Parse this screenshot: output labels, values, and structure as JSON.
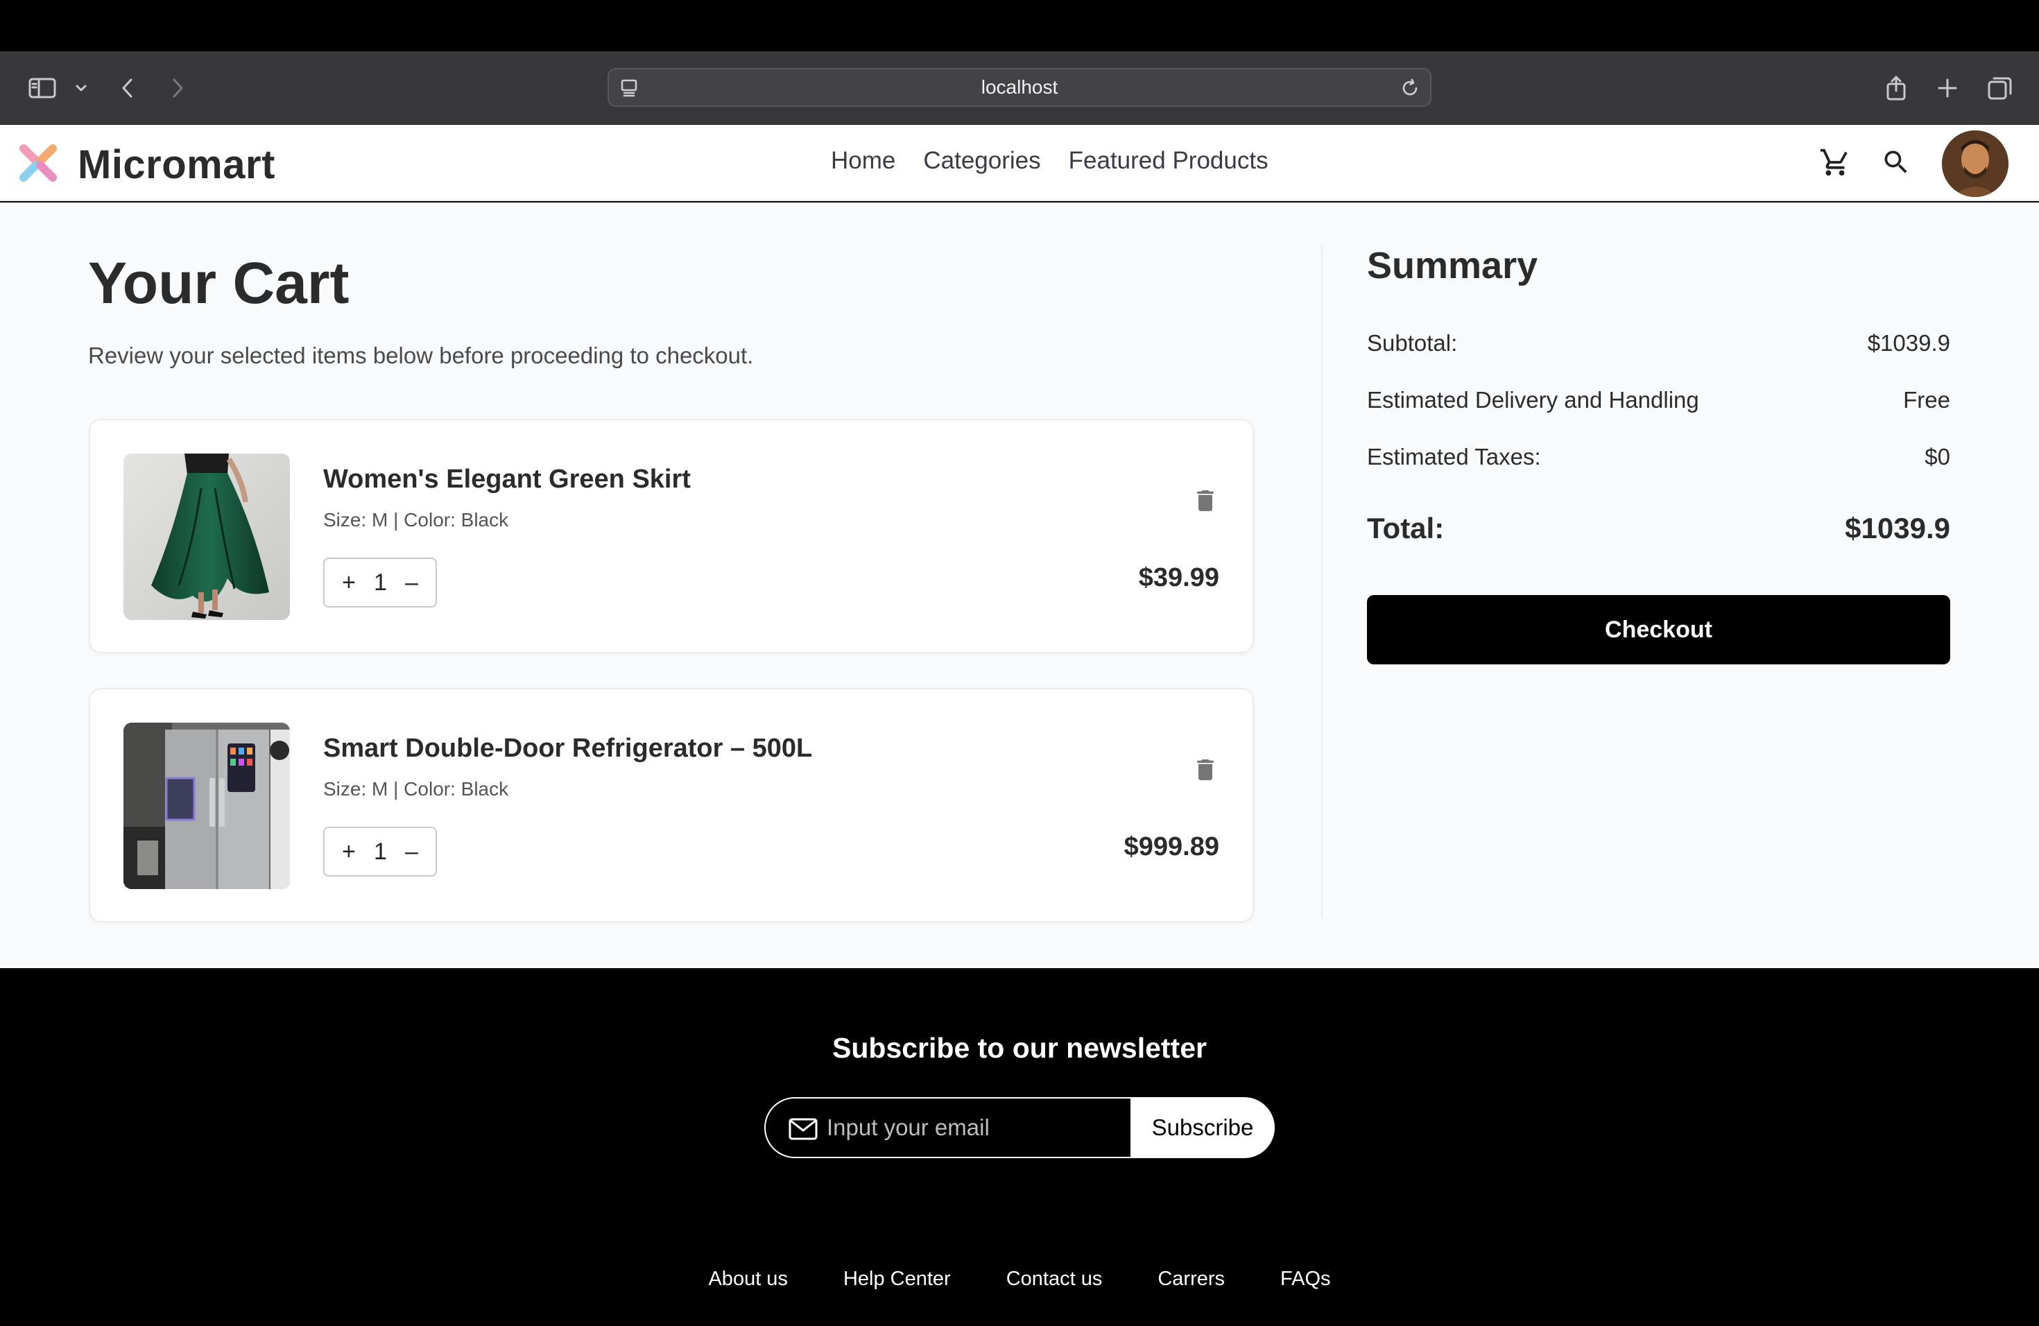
{
  "browser": {
    "url": "localhost"
  },
  "header": {
    "brand": "Micromart",
    "nav": [
      "Home",
      "Categories",
      "Featured Products"
    ],
    "icons": [
      "cart-icon",
      "search-icon"
    ]
  },
  "cart": {
    "title": "Your Cart",
    "subtitle": "Review your selected items below before proceeding to checkout.",
    "items": [
      {
        "name": "Women's Elegant Green Skirt",
        "meta": "Size: M | Color: Black",
        "qty": "1",
        "price": "$39.99"
      },
      {
        "name": "Smart Double-Door Refrigerator – 500L",
        "meta": "Size: M | Color: Black",
        "qty": "1",
        "price": "$999.89"
      }
    ],
    "qty_plus": "+",
    "qty_minus": "–"
  },
  "summary": {
    "title": "Summary",
    "subtotal_label": "Subtotal:",
    "subtotal_value": "$1039.9",
    "delivery_label": "Estimated Delivery and Handling",
    "delivery_value": "Free",
    "taxes_label": "Estimated Taxes:",
    "taxes_value": "$0",
    "total_label": "Total:",
    "total_value": "$1039.9",
    "checkout_label": "Checkout"
  },
  "footer": {
    "newsletter_title": "Subscribe to our newsletter",
    "email_placeholder": "Input your email",
    "subscribe_label": "Subscribe",
    "links": [
      "About us",
      "Help Center",
      "Contact us",
      "Carrers",
      "FAQs"
    ]
  }
}
